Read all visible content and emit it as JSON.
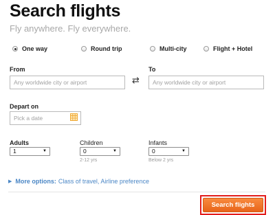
{
  "header": {
    "title": "Search flights",
    "subtitle": "Fly anywhere. Fly everywhere."
  },
  "trip_types": [
    {
      "label": "One way",
      "selected": true
    },
    {
      "label": "Round trip",
      "selected": false
    },
    {
      "label": "Multi-city",
      "selected": false
    },
    {
      "label": "Flight + Hotel",
      "selected": false
    }
  ],
  "from": {
    "label": "From",
    "placeholder": "Any worldwide city or airport",
    "value": ""
  },
  "to": {
    "label": "To",
    "placeholder": "Any worldwide city or airport",
    "value": ""
  },
  "swap_icon": "swap-arrows-icon",
  "depart": {
    "label": "Depart on",
    "placeholder": "Pick a date",
    "icon": "calendar-icon",
    "icon_color": "#f0a830"
  },
  "passengers": {
    "adults": {
      "label": "Adults",
      "value": "1"
    },
    "children": {
      "label": "Children",
      "value": "0",
      "hint": "2-12 yrs"
    },
    "infants": {
      "label": "Infants",
      "value": "0",
      "hint": "Below 2 yrs"
    }
  },
  "more_options": {
    "label": "More options:",
    "detail": "Class of travel, Airline preference"
  },
  "search_button": {
    "label": "Search flights",
    "color": "#f07a2e",
    "highlight_border": "#e21b1b"
  }
}
